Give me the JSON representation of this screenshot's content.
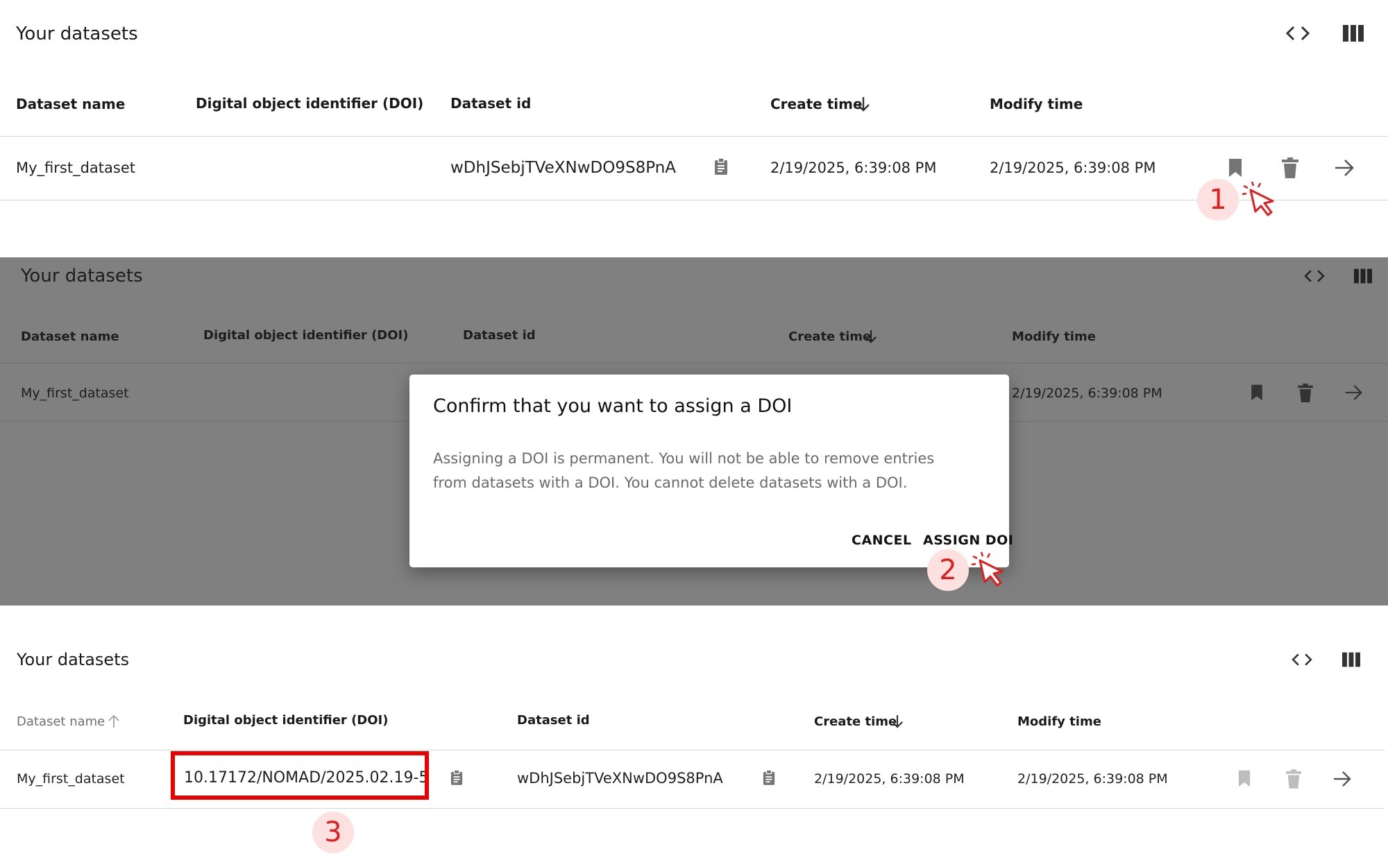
{
  "panel1": {
    "title": "Your datasets",
    "icons": [
      "code-icon",
      "view-column-icon"
    ],
    "columns": [
      "Dataset name",
      "Digital object identifier (DOI)",
      "Dataset id",
      "Create time",
      "Modify time"
    ],
    "row": {
      "name": "My_first_dataset",
      "doi": "",
      "id": "wDhJSebjTVeXNwDO9S8PnA",
      "create_time": "2/19/2025, 6:39:08 PM",
      "modify_time": "2/19/2025, 6:39:08 PM"
    },
    "step_badge": "1"
  },
  "panel2": {
    "title": "Your datasets",
    "columns": [
      "Dataset name",
      "Digital object identifier (DOI)",
      "Dataset id",
      "Create time",
      "Modify time"
    ],
    "row": {
      "name": "My_first_dataset",
      "modify_time": "2/19/2025, 6:39:08 PM"
    },
    "dialog": {
      "title": "Confirm that you want to assign a DOI",
      "body": "Assigning a DOI is permanent. You will not be able to remove entries from datasets with a DOI. You cannot delete datasets with a DOI.",
      "cancel_label": "CANCEL",
      "confirm_label": "ASSIGN DOI"
    },
    "step_badge": "2"
  },
  "panel3": {
    "title": "Your datasets",
    "columns": [
      "Dataset name",
      "Digital object identifier (DOI)",
      "Dataset id",
      "Create time",
      "Modify time"
    ],
    "row": {
      "name": "My_first_dataset",
      "doi": "10.17172/NOMAD/2025.02.19-5",
      "id": "wDhJSebjTVeXNwDO9S8PnA",
      "create_time": "2/19/2025, 6:39:08 PM",
      "modify_time": "2/19/2025, 6:39:08 PM"
    },
    "step_badge": "3"
  },
  "colors": {
    "accent_red": "#ee0000",
    "badge_bg": "#fde0e0",
    "overlay_gray": "#808080",
    "icon_gray": "#757575",
    "icon_disabled": "#bdbdbd"
  }
}
